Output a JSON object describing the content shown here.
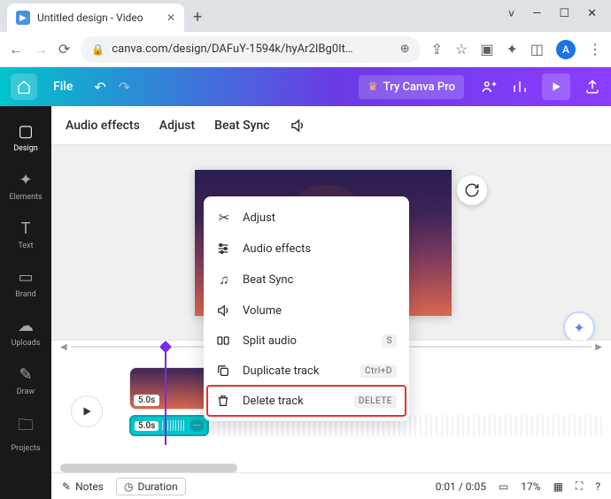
{
  "window": {
    "tab_title": "Untitled design - Video",
    "new_tab_icon": "+"
  },
  "browser": {
    "url": "canva.com/design/DAFuY-1594k/hyAr2IBg0It…",
    "avatar_letter": "A"
  },
  "canva_top": {
    "file_label": "File",
    "try_pro_label": "Try Canva Pro"
  },
  "sidebar": {
    "items": [
      {
        "label": "Design"
      },
      {
        "label": "Elements"
      },
      {
        "label": "Text"
      },
      {
        "label": "Brand"
      },
      {
        "label": "Uploads"
      },
      {
        "label": "Draw"
      },
      {
        "label": "Projects"
      }
    ]
  },
  "tool_strip": {
    "audio_effects": "Audio effects",
    "adjust": "Adjust",
    "beat_sync": "Beat Sync"
  },
  "context_menu": {
    "items": [
      {
        "label": "Adjust",
        "shortcut": ""
      },
      {
        "label": "Audio effects",
        "shortcut": ""
      },
      {
        "label": "Beat Sync",
        "shortcut": ""
      },
      {
        "label": "Volume",
        "shortcut": ""
      },
      {
        "label": "Split audio",
        "shortcut": "S"
      },
      {
        "label": "Duplicate track",
        "shortcut": "Ctrl+D"
      },
      {
        "label": "Delete track",
        "shortcut": "DELETE"
      }
    ]
  },
  "timeline": {
    "video_clip_duration": "5.0s",
    "audio_clip_duration": "5.0s"
  },
  "bottom_bar": {
    "notes_label": "Notes",
    "duration_label": "Duration",
    "time": "0:01 / 0:05",
    "zoom": "17%"
  }
}
